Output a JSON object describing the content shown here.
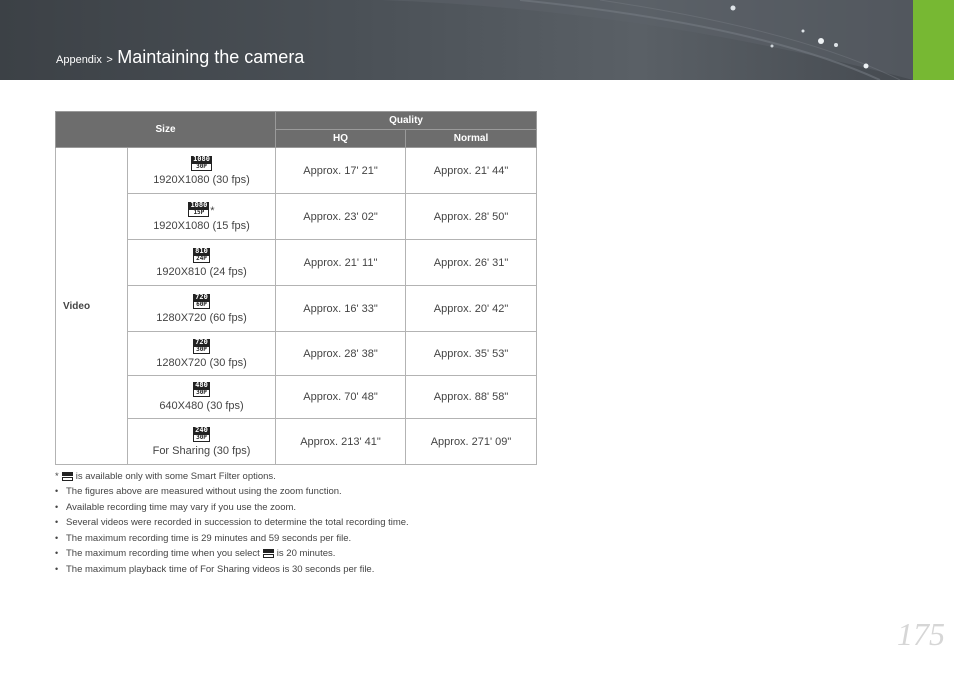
{
  "header": {
    "breadcrumb_parent": "Appendix",
    "breadcrumb_separator": ">",
    "title": "Maintaining the camera"
  },
  "colors": {
    "accent": "#77b833",
    "header_bg": "#4b5157",
    "table_header": "#6d6d6d"
  },
  "table": {
    "size_header": "Size",
    "quality_header": "Quality",
    "hq_header": "HQ",
    "normal_header": "Normal",
    "category": "Video",
    "rows": [
      {
        "icon_top": "1080",
        "icon_bottom": "30P",
        "size": "1920X1080 (30 fps)",
        "hq": "Approx. 17' 21\"",
        "normal": "Approx. 21' 44\"",
        "asterisk": ""
      },
      {
        "icon_top": "1080",
        "icon_bottom": "15P",
        "size": "1920X1080 (15 fps)",
        "hq": "Approx. 23' 02\"",
        "normal": "Approx. 28' 50\"",
        "asterisk": "*"
      },
      {
        "icon_top": "810",
        "icon_bottom": "24P",
        "size": "1920X810 (24 fps)",
        "hq": "Approx. 21' 11\"",
        "normal": "Approx. 26' 31\"",
        "asterisk": ""
      },
      {
        "icon_top": "720",
        "icon_bottom": "60P",
        "size": "1280X720 (60 fps)",
        "hq": "Approx. 16' 33\"",
        "normal": "Approx. 20' 42\"",
        "asterisk": ""
      },
      {
        "icon_top": "720",
        "icon_bottom": "30P",
        "size": "1280X720 (30 fps)",
        "hq": "Approx. 28' 38\"",
        "normal": "Approx. 35' 53\"",
        "asterisk": ""
      },
      {
        "icon_top": "480",
        "icon_bottom": "30P",
        "size": "640X480 (30 fps)",
        "hq": "Approx. 70' 48\"",
        "normal": "Approx. 88' 58\"",
        "asterisk": ""
      },
      {
        "icon_top": "240",
        "icon_bottom": "30P",
        "size": "For Sharing (30 fps)",
        "hq": "Approx. 213' 41\"",
        "normal": "Approx. 271' 09\"",
        "asterisk": ""
      }
    ]
  },
  "notes": {
    "footnote_mark": "*",
    "footnote_text": "is available only with some Smart Filter options.",
    "bullet": "•",
    "bullets": [
      "The figures above are measured without using the zoom function.",
      "Available recording time may vary if you use the zoom.",
      "Several videos were recorded in succession to determine the total recording time.",
      "The maximum recording time is 29 minutes and 59 seconds per file."
    ],
    "select_note_before": "The maximum recording time when you select",
    "select_note_after": "is 20 minutes.",
    "last_bullet": "The maximum playback time of For Sharing videos is 30 seconds per file."
  },
  "page_number": "175"
}
